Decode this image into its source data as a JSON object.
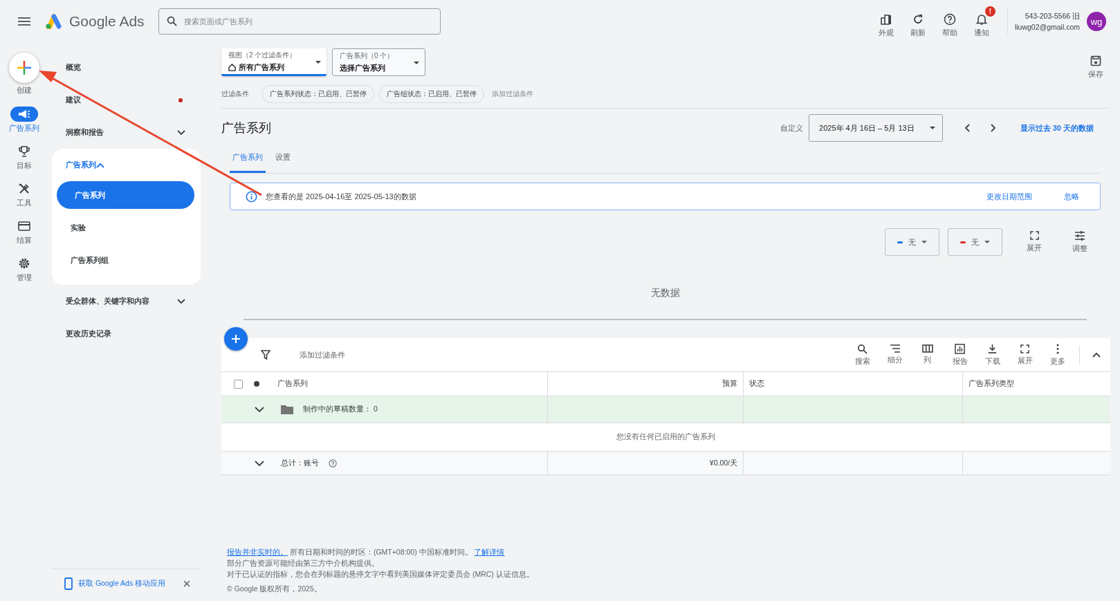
{
  "header": {
    "product": "Google Ads",
    "search": {
      "placeholder": "搜索页面或广告系列"
    },
    "actions": [
      {
        "kind": "appearance",
        "label": "外观"
      },
      {
        "kind": "refresh",
        "label": "刷新"
      },
      {
        "kind": "help",
        "label": "帮助"
      },
      {
        "kind": "notifications",
        "label": "通知",
        "badge": "!"
      }
    ],
    "account": {
      "id": "543-203-5566 旧",
      "email": "liuwg02@gmail.com",
      "avatar": "wg"
    }
  },
  "rail": {
    "create": "创建",
    "items": [
      {
        "kind": "campaigns",
        "label": "广告系列",
        "selected": true
      },
      {
        "kind": "goals",
        "label": "目标",
        "selected": false
      },
      {
        "kind": "tools",
        "label": "工具",
        "selected": false
      },
      {
        "kind": "billing",
        "label": "结算",
        "selected": false
      },
      {
        "kind": "admin",
        "label": "管理",
        "selected": false
      }
    ]
  },
  "nav": {
    "items": [
      {
        "label": "概览",
        "kind": "link",
        "dot": false
      },
      {
        "label": "建议",
        "kind": "link",
        "dot": true
      },
      {
        "label": "洞察和报告",
        "kind": "group",
        "expanded": false
      },
      {
        "label": "广告系列",
        "kind": "group",
        "expanded": true,
        "children": [
          {
            "label": "广告系列",
            "selected": true
          },
          {
            "label": "实验",
            "selected": false
          },
          {
            "label": "广告系列组",
            "selected": false
          }
        ]
      },
      {
        "label": "受众群体、关键字和内容",
        "kind": "group",
        "expanded": false
      },
      {
        "label": "更改历史记录",
        "kind": "link",
        "dot": false
      }
    ],
    "promo": "获取 Google Ads 移动应用"
  },
  "filters": {
    "view": {
      "caption": "视图（2 个过滤条件）",
      "value": "所有广告系列"
    },
    "campaign_picker": {
      "caption": "广告系列（0 个）",
      "value": "选择广告系列"
    },
    "label": "过滤条件",
    "chips": [
      "广告系列状态：已启用、已暂停",
      "广告组状态：已启用、已暂停"
    ],
    "add": "添加过滤条件",
    "save": "保存"
  },
  "page": {
    "title": "广告系列",
    "range_kind": "自定义",
    "date_range": "2025年 4月 16日 – 5月 13日",
    "last30": "显示过去 30 天的数据"
  },
  "tabs": [
    {
      "label": "广告系列",
      "selected": true
    },
    {
      "label": "设置",
      "selected": false
    }
  ],
  "banner": {
    "text": "您查看的是 2025-04-16至 2025-05-13的数据",
    "change": "更改日期范围",
    "dismiss": "忽略"
  },
  "chart_controls": {
    "metrics": [
      {
        "label": "无",
        "color": "#1a73e8"
      },
      {
        "label": "无",
        "color": "#d93025"
      }
    ],
    "expand": "展开",
    "adjust": "调整",
    "empty": "无数据"
  },
  "table": {
    "add_filter": "添加过滤条件",
    "tools": [
      {
        "kind": "search",
        "label": "搜索"
      },
      {
        "kind": "segment",
        "label": "细分"
      },
      {
        "kind": "columns",
        "label": "列"
      },
      {
        "kind": "report",
        "label": "报告"
      },
      {
        "kind": "download",
        "label": "下载"
      },
      {
        "kind": "expand",
        "label": "展开"
      },
      {
        "kind": "more",
        "label": "更多"
      }
    ],
    "select_all": {
      "checked": false
    },
    "columns": [
      "广告系列",
      "预算",
      "状态",
      "广告系列类型"
    ],
    "draft": "制作中的草稿数量： 0",
    "empty": "您没有任何已启用的广告系列",
    "total": {
      "label": "总计：账号",
      "budget": "¥0.00/天"
    }
  },
  "footer": {
    "not_realtime": "报告并非实时的。",
    "timezone": "所有日期和时间的时区：(GMT+08:00) 中国标准时间。",
    "learn_more": "了解详情",
    "lines": [
      "部分广告资源可能经由第三方中介机构提供。",
      "对于已认证的指标，您会在列标题的悬停文字中看到美国媒体评定委员会 (MRC) 认证信息。"
    ],
    "copyright": "© Google 版权所有，2025。"
  }
}
